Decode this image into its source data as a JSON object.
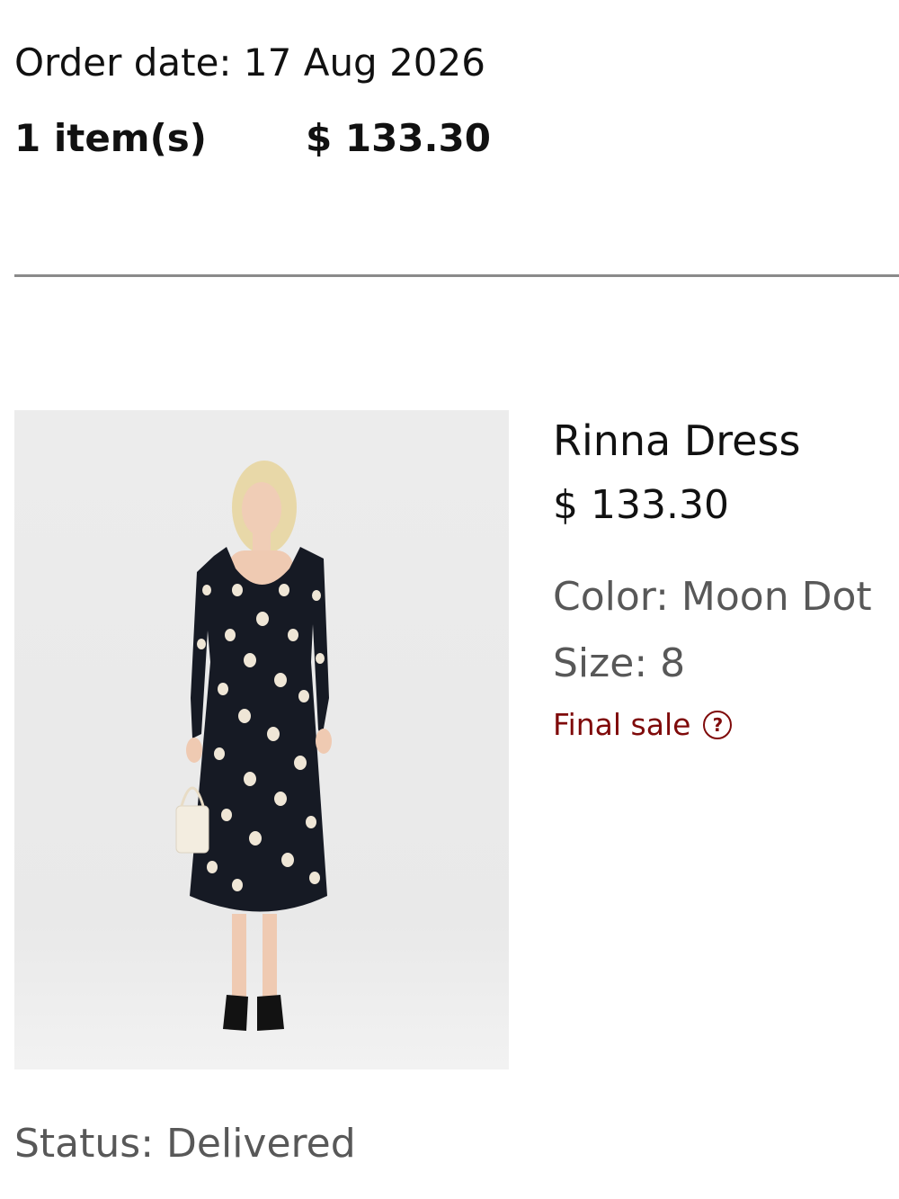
{
  "order": {
    "date_text": "Order date: 17 Aug 2026",
    "item_count": "1 item(s)",
    "total": "$ 133.30"
  },
  "product": {
    "name": "Rinna Dress",
    "price": "$ 133.30",
    "color": "Color: Moon Dot",
    "size": "Size: 8",
    "final_sale": "Final sale",
    "help_icon": "question-circle-icon"
  },
  "shipment": {
    "status": "Status: Delivered"
  }
}
